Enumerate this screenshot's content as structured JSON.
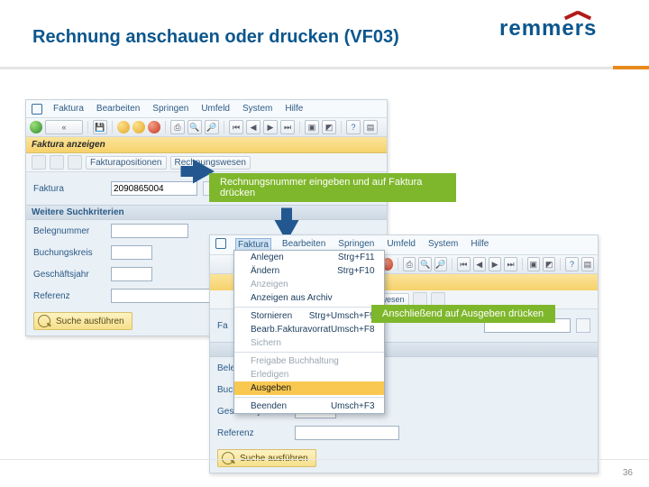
{
  "slide": {
    "title": "Rechnung anschauen oder drucken (VF03)",
    "page": "36"
  },
  "brand": {
    "name": "remmers"
  },
  "callouts": {
    "step1": "Rechnungsnummer eingeben und auf Faktura drücken",
    "step2": "Anschließend auf Ausgeben drücken"
  },
  "sap": {
    "menu": {
      "faktura": "Faktura",
      "bearbeiten": "Bearbeiten",
      "springen": "Springen",
      "umfeld": "Umfeld",
      "system": "System",
      "hilfe": "Hilfe"
    },
    "title": "Faktura anzeigen",
    "sub_buttons": {
      "pos": "Fakturapositionen",
      "rw": "Rechnungswesen"
    },
    "field_faktura_label": "Faktura",
    "field_faktura_value": "2090865004",
    "section_weitere": "Weitere Suchkriterien",
    "labels": {
      "belegnummer": "Belegnummer",
      "buchungskreis": "Buchungskreis",
      "geschaeftsjahr": "Geschäftsjahr",
      "referenz": "Referenz"
    },
    "search_exec": "Suche ausführen"
  },
  "dropdown": {
    "anlegen": {
      "label": "Anlegen",
      "short": "Strg+F11"
    },
    "aendern": {
      "label": "Ändern",
      "short": "Strg+F10"
    },
    "anzeigen": {
      "label": "Anzeigen"
    },
    "archiv": {
      "label": "Anzeigen aus Archiv"
    },
    "stornieren": {
      "label": "Stornieren",
      "short": "Strg+Umsch+F9"
    },
    "vorrat": {
      "label": "Bearb.Fakturavorrat",
      "short": "Umsch+F8"
    },
    "sichern": {
      "label": "Sichern"
    },
    "freigabe": {
      "label": "Freigabe Buchhaltung"
    },
    "erledigen": {
      "label": "Erledigen"
    },
    "ausgeben": {
      "label": "Ausgeben"
    },
    "beenden": {
      "label": "Beenden",
      "short": "Umsch+F3"
    }
  }
}
